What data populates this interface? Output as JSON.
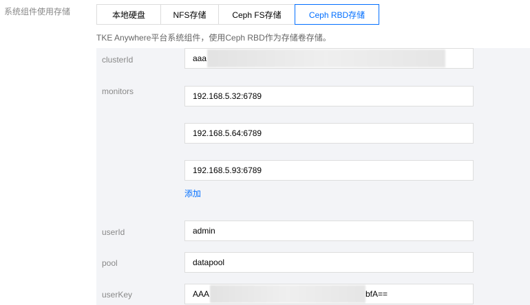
{
  "side_label": "系统组件使用存储",
  "tabs": [
    {
      "label": "本地硬盘"
    },
    {
      "label": "NFS存储"
    },
    {
      "label": "Ceph FS存储"
    },
    {
      "label": "Ceph RBD存储"
    }
  ],
  "active_tab": "Ceph RBD存储",
  "description": "TKE Anywhere平台系统组件，使用Ceph RBD作为存储卷存储。",
  "form": {
    "cluster_id": {
      "label": "clusterId",
      "value": "aaa"
    },
    "monitors": {
      "label": "monitors",
      "items": [
        "192.168.5.32:6789",
        "192.168.5.64:6789",
        "192.168.5.93:6789"
      ],
      "add_label": "添加"
    },
    "user_id": {
      "label": "userId",
      "value": "admin"
    },
    "pool": {
      "label": "pool",
      "value": "datapool"
    },
    "user_key": {
      "label": "userKey",
      "value_prefix": "AAA",
      "value_suffix": "bfA=="
    }
  },
  "colors": {
    "accent": "#006eff",
    "panel_bg": "#f3f4f7",
    "muted_text": "#888888"
  }
}
